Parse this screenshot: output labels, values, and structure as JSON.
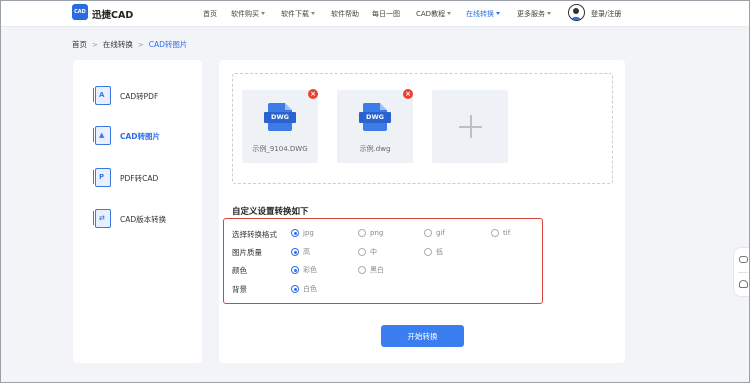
{
  "header": {
    "logo_text": "CAD",
    "brand": "迅捷CAD",
    "nav": [
      {
        "label": "首页",
        "dropdown": false,
        "active": false
      },
      {
        "label": "软件购买",
        "dropdown": true,
        "active": false
      },
      {
        "label": "软件下载",
        "dropdown": true,
        "active": false
      },
      {
        "label": "软件帮助",
        "dropdown": false,
        "active": false
      },
      {
        "label": "每日一图",
        "dropdown": false,
        "active": false
      },
      {
        "label": "CAD教程",
        "dropdown": true,
        "active": false
      },
      {
        "label": "在线转换",
        "dropdown": true,
        "active": true
      },
      {
        "label": "更多服务",
        "dropdown": true,
        "active": false
      }
    ],
    "login": "登录/注册"
  },
  "breadcrumb": [
    "首页",
    "在线转换",
    "CAD转图片"
  ],
  "sidebar": {
    "items": [
      {
        "label": "CAD转PDF",
        "icon": "cad-to-pdf-icon",
        "active": false
      },
      {
        "label": "CAD转图片",
        "icon": "cad-to-image-icon",
        "active": true
      },
      {
        "label": "PDF转CAD",
        "icon": "pdf-to-cad-icon",
        "active": false
      },
      {
        "label": "CAD版本转换",
        "icon": "cad-version-icon",
        "active": false
      }
    ]
  },
  "files": [
    {
      "badge": "DWG",
      "name": "示例_9104.DWG"
    },
    {
      "badge": "DWG",
      "name": "示例.dwg"
    }
  ],
  "settings": {
    "title": "自定义设置转换如下",
    "rows": [
      {
        "label": "选择转换格式",
        "options": [
          "jpg",
          "png",
          "gif",
          "tif"
        ],
        "selected": "jpg"
      },
      {
        "label": "图片质量",
        "options": [
          "高",
          "中",
          "低"
        ],
        "selected": "高"
      },
      {
        "label": "颜色",
        "options": [
          "彩色",
          "黑白"
        ],
        "selected": "彩色"
      },
      {
        "label": "背景",
        "options": [
          "白色"
        ],
        "selected": "白色"
      }
    ]
  },
  "start_button": "开始转换",
  "colors": {
    "accent": "#2e6fe8",
    "button": "#3b7ef0",
    "highlight_border": "#d9443a",
    "close": "#e9412e"
  }
}
